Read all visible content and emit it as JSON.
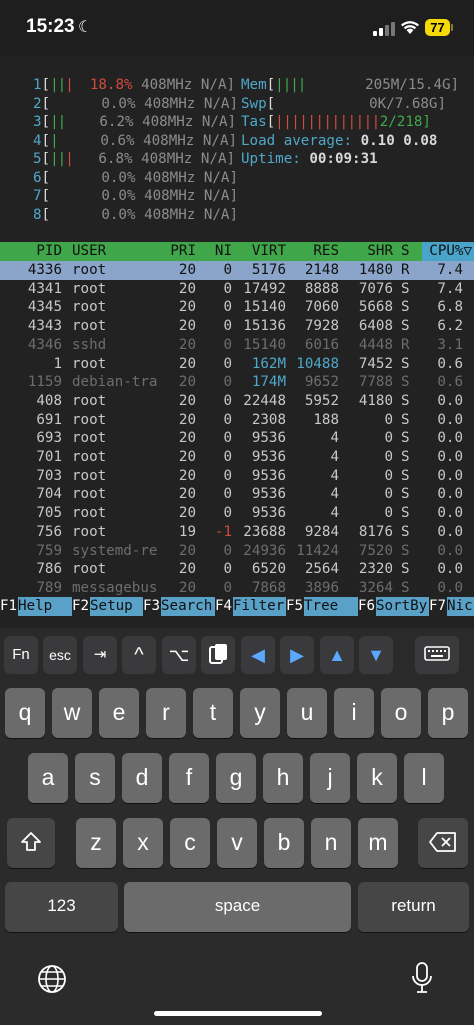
{
  "status": {
    "time": "15:23",
    "battery": "77"
  },
  "cpu_meters": [
    {
      "num": "1",
      "bars": "|||",
      "pct": "18.8%",
      "freq": "408MHz N/A]"
    },
    {
      "num": "2",
      "bars": "",
      "pct": "0.0%",
      "freq": "408MHz N/A]"
    },
    {
      "num": "3",
      "bars": "||",
      "pct": "6.2%",
      "freq": "408MHz N/A]"
    },
    {
      "num": "4",
      "bars": "|",
      "pct": "0.6%",
      "freq": "408MHz N/A]"
    },
    {
      "num": "5",
      "bars": "|||",
      "pct": "6.8%",
      "freq": "408MHz N/A]"
    },
    {
      "num": "6",
      "bars": "",
      "pct": "0.0%",
      "freq": "408MHz N/A]"
    },
    {
      "num": "7",
      "bars": "",
      "pct": "0.0%",
      "freq": "408MHz N/A]"
    },
    {
      "num": "8",
      "bars": "",
      "pct": "0.0%",
      "freq": "408MHz N/A]"
    }
  ],
  "summary": {
    "mem_label": "Mem",
    "mem_bars": "||||",
    "mem_value": "205M/15.4G]",
    "swp_label": "Swp",
    "swp_value": "0K/7.68G]",
    "tasks_label": "Tas",
    "tasks_bars": "|||||||||||||",
    "tasks_value": "2/218]",
    "load_label": "Load average:",
    "load_values": "0.10 0.08",
    "uptime_label": "Uptime:",
    "uptime_value": "00:09:31"
  },
  "columns": [
    "PID",
    "USER",
    "PRI",
    "NI",
    "VIRT",
    "RES",
    "SHR",
    "S",
    "CPU%▽"
  ],
  "processes": [
    {
      "pid": "4336",
      "user": "root",
      "pri": "20",
      "ni": "0",
      "virt": "5176",
      "res": "2148",
      "shr": "1480",
      "s": "R",
      "cpu": "7.4"
    },
    {
      "pid": "4341",
      "user": "root",
      "pri": "20",
      "ni": "0",
      "virt": "17492",
      "res": "8888",
      "shr": "7076",
      "s": "S",
      "cpu": "7.4"
    },
    {
      "pid": "4345",
      "user": "root",
      "pri": "20",
      "ni": "0",
      "virt": "15140",
      "res": "7060",
      "shr": "5668",
      "s": "S",
      "cpu": "6.8"
    },
    {
      "pid": "4343",
      "user": "root",
      "pri": "20",
      "ni": "0",
      "virt": "15136",
      "res": "7928",
      "shr": "6408",
      "s": "S",
      "cpu": "6.2"
    },
    {
      "pid": "4346",
      "user": "sshd",
      "pri": "20",
      "ni": "0",
      "virt": "15140",
      "res": "6016",
      "shr": "4448",
      "s": "R",
      "cpu": "3.1"
    },
    {
      "pid": "1",
      "user": "root",
      "pri": "20",
      "ni": "0",
      "virt": "162M",
      "res": "10488",
      "shr": "7452",
      "s": "S",
      "cpu": "0.6"
    },
    {
      "pid": "1159",
      "user": "debian-tra",
      "pri": "20",
      "ni": "0",
      "virt": "174M",
      "res": "9652",
      "shr": "7788",
      "s": "S",
      "cpu": "0.6"
    },
    {
      "pid": "408",
      "user": "root",
      "pri": "20",
      "ni": "0",
      "virt": "22448",
      "res": "5952",
      "shr": "4180",
      "s": "S",
      "cpu": "0.0"
    },
    {
      "pid": "691",
      "user": "root",
      "pri": "20",
      "ni": "0",
      "virt": "2308",
      "res": "188",
      "shr": "0",
      "s": "S",
      "cpu": "0.0"
    },
    {
      "pid": "693",
      "user": "root",
      "pri": "20",
      "ni": "0",
      "virt": "9536",
      "res": "4",
      "shr": "0",
      "s": "S",
      "cpu": "0.0"
    },
    {
      "pid": "701",
      "user": "root",
      "pri": "20",
      "ni": "0",
      "virt": "9536",
      "res": "4",
      "shr": "0",
      "s": "S",
      "cpu": "0.0"
    },
    {
      "pid": "703",
      "user": "root",
      "pri": "20",
      "ni": "0",
      "virt": "9536",
      "res": "4",
      "shr": "0",
      "s": "S",
      "cpu": "0.0"
    },
    {
      "pid": "704",
      "user": "root",
      "pri": "20",
      "ni": "0",
      "virt": "9536",
      "res": "4",
      "shr": "0",
      "s": "S",
      "cpu": "0.0"
    },
    {
      "pid": "705",
      "user": "root",
      "pri": "20",
      "ni": "0",
      "virt": "9536",
      "res": "4",
      "shr": "0",
      "s": "S",
      "cpu": "0.0"
    },
    {
      "pid": "756",
      "user": "root",
      "pri": "19",
      "ni": "-1",
      "virt": "23688",
      "res": "9284",
      "shr": "8176",
      "s": "S",
      "cpu": "0.0"
    },
    {
      "pid": "759",
      "user": "systemd-re",
      "pri": "20",
      "ni": "0",
      "virt": "24936",
      "res": "11424",
      "shr": "7520",
      "s": "S",
      "cpu": "0.0"
    },
    {
      "pid": "786",
      "user": "root",
      "pri": "20",
      "ni": "0",
      "virt": "6520",
      "res": "2564",
      "shr": "2320",
      "s": "S",
      "cpu": "0.0"
    },
    {
      "pid": "789",
      "user": "messagebus",
      "pri": "20",
      "ni": "0",
      "virt": "7868",
      "res": "3896",
      "shr": "3264",
      "s": "S",
      "cpu": "0.0"
    }
  ],
  "fkeys": [
    {
      "key": "F1",
      "label": "Help"
    },
    {
      "key": "F2",
      "label": "Setup"
    },
    {
      "key": "F3",
      "label": "Search"
    },
    {
      "key": "F4",
      "label": "Filter"
    },
    {
      "key": "F5",
      "label": "Tree"
    },
    {
      "key": "F6",
      "label": "SortBy"
    },
    {
      "key": "F7",
      "label": "Nic"
    }
  ],
  "toolbar": {
    "fn": "Fn",
    "esc": "esc",
    "tab": "⇥",
    "ctrl": "^",
    "alt": "⌥",
    "paste": "paste-icon",
    "left": "◀",
    "right": "▶",
    "up": "▲",
    "down": "▼",
    "hide": "keyboard-hide-icon"
  },
  "keyboard": {
    "row1": [
      "q",
      "w",
      "e",
      "r",
      "t",
      "y",
      "u",
      "i",
      "o",
      "p"
    ],
    "row2": [
      "a",
      "s",
      "d",
      "f",
      "g",
      "h",
      "j",
      "k",
      "l"
    ],
    "row3": [
      "z",
      "x",
      "c",
      "v",
      "b",
      "n",
      "m"
    ],
    "numbers": "123",
    "space": "space",
    "return": "return"
  }
}
